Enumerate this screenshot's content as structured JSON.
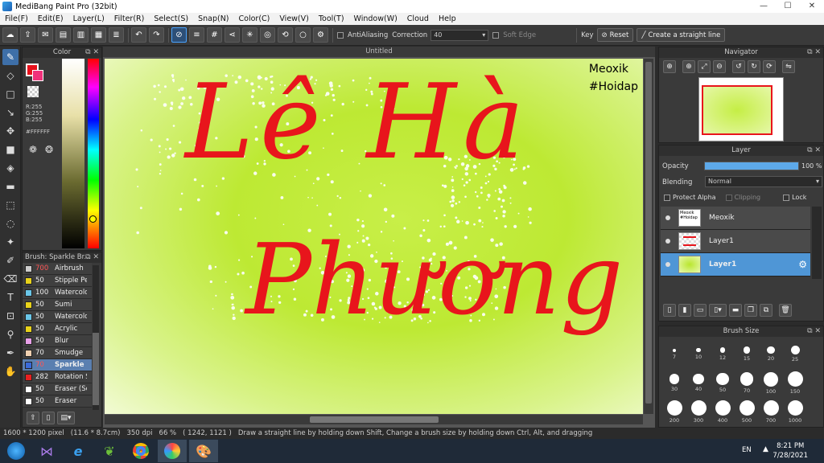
{
  "window": {
    "title": "MediBang Paint Pro (32bit)",
    "minimize": "—",
    "maximize": "☐",
    "close": "✕"
  },
  "menu": [
    "File(F)",
    "Edit(E)",
    "Layer(L)",
    "Filter(R)",
    "Select(S)",
    "Snap(N)",
    "Color(C)",
    "View(V)",
    "Tool(T)",
    "Window(W)",
    "Cloud",
    "Help"
  ],
  "toolbar": {
    "antialiasing_label": "AntiAliasing",
    "correction_label": "Correction",
    "correction_value": "40",
    "soft_edge_label": "Soft Edge",
    "key_label": "Key",
    "reset_label": "Reset",
    "straight_line_label": "Create a straight line"
  },
  "color_panel": {
    "title": "Color",
    "r": "R:255",
    "g": "G:255",
    "b": "B:255",
    "hex": "#FFFFFF",
    "primary_color": "#e8101b",
    "secondary_color": "#ffffff"
  },
  "brush_panel": {
    "title": "Brush: Sparkle Br...",
    "items": [
      {
        "size": "700",
        "name": "Airbrush",
        "color": "#cccccc"
      },
      {
        "size": "50",
        "name": "Stipple Pe",
        "color": "#e8d21a"
      },
      {
        "size": "100",
        "name": "Watercolo",
        "color": "#6ac6e8"
      },
      {
        "size": "50",
        "name": "Sumi",
        "color": "#e8d21a"
      },
      {
        "size": "50",
        "name": "Watercolo",
        "color": "#6ac6e8"
      },
      {
        "size": "50",
        "name": "Acrylic",
        "color": "#e8d21a"
      },
      {
        "size": "50",
        "name": "Blur",
        "color": "#e8a0e8"
      },
      {
        "size": "70",
        "name": "Smudge",
        "color": "#f0d0b0"
      },
      {
        "size": "70",
        "name": "Sparkle",
        "color": "#3a6ad8"
      },
      {
        "size": "282",
        "name": "Rotation S",
        "color": "#e82020"
      },
      {
        "size": "50",
        "name": "Eraser (Sc",
        "color": "#ffffff"
      },
      {
        "size": "50",
        "name": "Eraser",
        "color": "#ffffff"
      }
    ]
  },
  "document": {
    "tab_title": "Untitled",
    "watermark_line1": "Meoxik",
    "watermark_line2": "#Hoidap",
    "lettering_line1": "Lê Hà",
    "lettering_line2": "Phương"
  },
  "navigator": {
    "title": "Navigator"
  },
  "layer_panel": {
    "title": "Layer",
    "opacity_label": "Opacity",
    "opacity_value": "100 %",
    "opacity_fraction": 1.0,
    "blending_label": "Blending",
    "blending_value": "Normal",
    "protect_alpha": "Protect Alpha",
    "clipping": "Clipping",
    "lock": "Lock",
    "layers": [
      {
        "name": "Meoxik",
        "thumb_text": "Meoxik #Hoidap"
      },
      {
        "name": "Layer1",
        "thumb_text": ""
      },
      {
        "name": "Layer1",
        "thumb_text": ""
      }
    ]
  },
  "brush_size_panel": {
    "title": "Brush Size",
    "sizes": [
      "7",
      "10",
      "12",
      "15",
      "20",
      "25",
      "30",
      "40",
      "50",
      "70",
      "100",
      "150",
      "200",
      "300",
      "400",
      "500",
      "700",
      "1000"
    ]
  },
  "status": {
    "size": "1600 * 1200 pixel",
    "physical": "(11.6 * 8.7cm)",
    "dpi": "350 dpi",
    "zoom": "66 %",
    "coords": "( 1242, 1121 )",
    "hint": "Draw a straight line by holding down Shift, Change a brush size by holding down Ctrl, Alt, and dragging"
  },
  "taskbar": {
    "lang": "EN",
    "time": "8:21 PM",
    "date": "7/28/2021"
  }
}
